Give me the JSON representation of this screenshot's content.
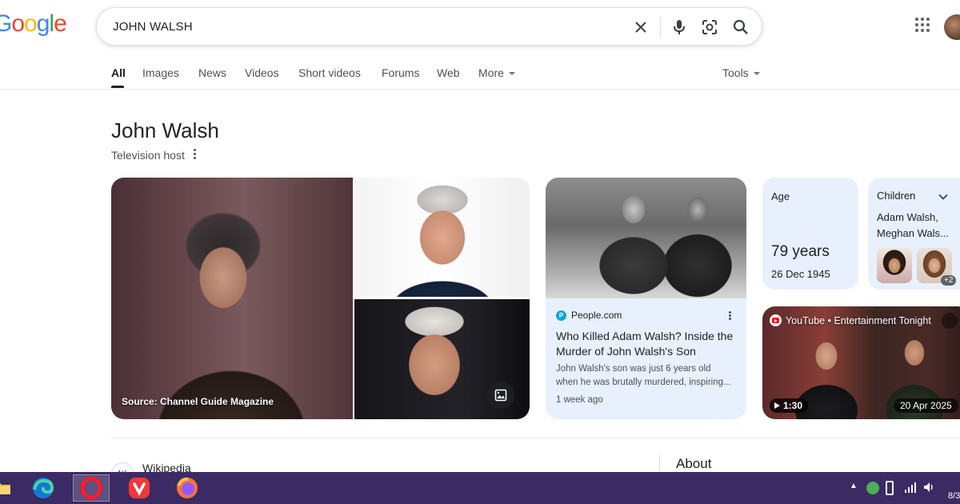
{
  "search": {
    "query": "JOHN WALSH",
    "logo_text": "Google"
  },
  "tabs": [
    {
      "label": "All",
      "active": true
    },
    {
      "label": "Images"
    },
    {
      "label": "News"
    },
    {
      "label": "Videos"
    },
    {
      "label": "Short videos"
    },
    {
      "label": "Forums"
    },
    {
      "label": "Web"
    },
    {
      "label": "More"
    }
  ],
  "tools_label": "Tools",
  "entity": {
    "title": "John Walsh",
    "subtitle": "Television host"
  },
  "images": {
    "main_caption": "Source: Channel Guide Magazine"
  },
  "article": {
    "source": "People.com",
    "source_initial": "P",
    "title": "Who Killed Adam Walsh? Inside the Murder of John Walsh's Son",
    "snippet_line1": "John Walsh's son was just 6 years old",
    "snippet_line2": "when he was brutally murdered, inspiring...",
    "time": "1 week ago"
  },
  "age": {
    "label": "Age",
    "value": "79 years",
    "birth_date": "26 Dec 1945"
  },
  "children": {
    "label": "Children",
    "names_line1": "Adam Walsh,",
    "names_line2": "Meghan Wals...",
    "more_badge": "+2"
  },
  "video": {
    "source": "YouTube • Entertainment Tonight",
    "duration": "1:30",
    "date": "20 Apr 2025"
  },
  "below": {
    "wiki_label": "Wikipedia",
    "wiki_icon_text": "W",
    "about_title": "About"
  },
  "taskbar": {
    "background": "#3b2a63",
    "apps": [
      "file-explorer",
      "edge",
      "opera",
      "vivaldi",
      "firefox"
    ],
    "clock_partial": "8/3"
  },
  "colors": {
    "card_bg": "#e8f0fe",
    "google_blue": "#4285f4",
    "google_red": "#ea4335",
    "google_yellow": "#fbbc05",
    "google_green": "#34a853"
  }
}
